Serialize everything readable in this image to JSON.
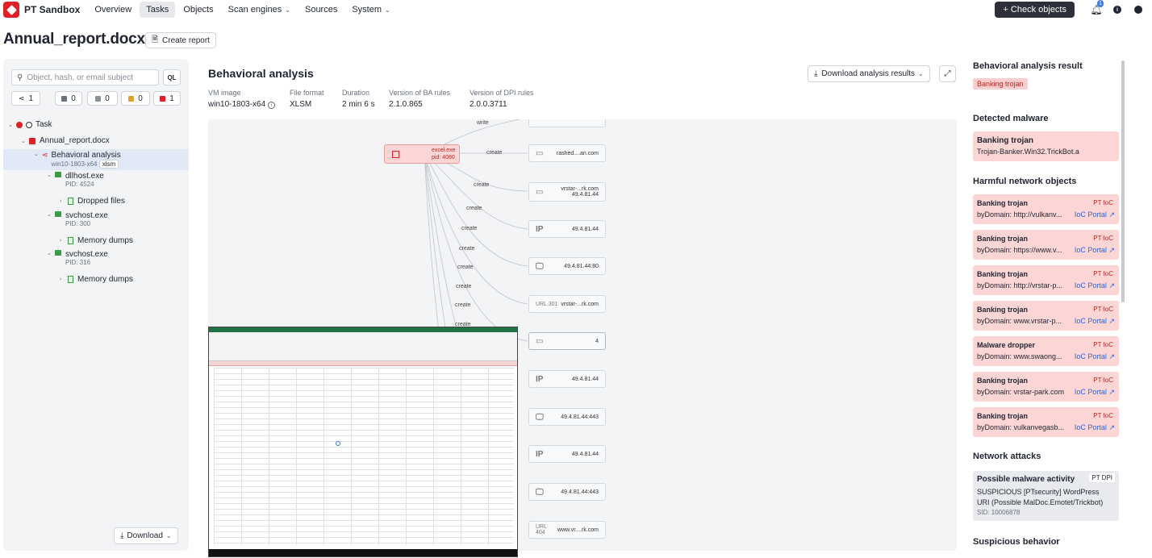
{
  "nav": {
    "brand": "PT Sandbox",
    "items": [
      "Overview",
      "Tasks",
      "Objects",
      "Scan engines",
      "Sources",
      "System"
    ],
    "check_objects": "+ Check objects",
    "notif_count": "1"
  },
  "page": {
    "title": "Annual_report.docx",
    "create_report": "Create report"
  },
  "left": {
    "search_placeholder": "Object, hash, or email subject",
    "ql": "QL",
    "counts": [
      "1",
      "0",
      "0",
      "0",
      "1"
    ],
    "tree": {
      "task": "Task",
      "file": "Annual_report.docx",
      "ba": "Behavioral analysis",
      "ba_sub": "win10-1803-x64",
      "ba_tag": "xlsm",
      "p1": "dllhost.exe",
      "p1_pid": "PID: 4524",
      "p1_child": "Dropped files",
      "p2": "svchost.exe",
      "p2_pid": "PID: 300",
      "p2_child": "Memory dumps",
      "p3": "svchost.exe",
      "p3_pid": "PID: 316",
      "p3_child": "Memory dumps"
    },
    "download": "Download"
  },
  "main": {
    "title": "Behavioral analysis",
    "download_results": "Download analysis results",
    "meta": [
      {
        "label": "VM image",
        "value": "win10-1803-x64"
      },
      {
        "label": "File format",
        "value": "XLSM"
      },
      {
        "label": "Duration",
        "value": "2 min 6 s"
      },
      {
        "label": "Version of BA rules",
        "value": "2.1.0.865"
      },
      {
        "label": "Version of DPI rules",
        "value": "2.0.0.3711"
      }
    ]
  },
  "graph": {
    "root": {
      "name": "excel.exe",
      "pid": "pid: 4080"
    },
    "edges": [
      "write",
      "create",
      "create",
      "create",
      "create",
      "create",
      "create",
      "create",
      "create",
      "create"
    ],
    "nodes": [
      {
        "icon": "▭",
        "text": "rashed....an.com"
      },
      {
        "icon": "▭",
        "text": "vrstar-...rk.com 49.4.81.44"
      },
      {
        "icon": "IP",
        "text": "49.4.81.44"
      },
      {
        "icon": "🖵",
        "text": "49.4.81.44:80"
      },
      {
        "icon": "URL 301",
        "text": "vrstar-...rk.com"
      },
      {
        "icon": "▭",
        "text": "4"
      },
      {
        "icon": "IP",
        "text": "49.4.81.44"
      },
      {
        "icon": "🖵",
        "text": "49.4.81.44:443"
      },
      {
        "icon": "IP",
        "text": "49.4.81.44"
      },
      {
        "icon": "🖵",
        "text": "49.4.81.44:443"
      },
      {
        "icon": "URL 404",
        "text": "www.vr....rk.com"
      }
    ]
  },
  "right": {
    "ba_result_title": "Behavioral analysis result",
    "ba_result_tag": "Banking trojan",
    "detected_title": "Detected malware",
    "detected": {
      "name": "Banking trojan",
      "detail": "Trojan-Banker.Win32.TrickBot.a"
    },
    "harmful_title": "Harmful network objects",
    "harmful": [
      {
        "name": "Banking trojan",
        "detail": "byDomain: http://vulkanv..."
      },
      {
        "name": "Banking trojan",
        "detail": "byDomain: https://www.v..."
      },
      {
        "name": "Banking trojan",
        "detail": "byDomain: http://vrstar-p..."
      },
      {
        "name": "Banking trojan",
        "detail": "byDomain: www.vrstar-p..."
      },
      {
        "name": "Malware dropper",
        "detail": "byDomain: www.swaong..."
      },
      {
        "name": "Banking trojan",
        "detail": "byDomain: vrstar-park.com"
      },
      {
        "name": "Banking trojan",
        "detail": "byDomain: vulkanvegasb..."
      }
    ],
    "pt_ioc": "PT IoC",
    "ioc_portal": "IoC Portal",
    "attacks_title": "Network attacks",
    "attack": {
      "name": "Possible malware activity",
      "tag": "PT DPI",
      "detail1": "SUSPICIOUS [PTsecurity] WordPress",
      "detail2": "URI (Possible MalDoc.Emotet/Trickbot)",
      "sid": "SID: 10006878"
    },
    "suspicious_title": "Suspicious behavior"
  },
  "colors": {
    "accent_red": "#e21f26",
    "alert_bg": "#fcd6d4",
    "link": "#2a64d8"
  }
}
